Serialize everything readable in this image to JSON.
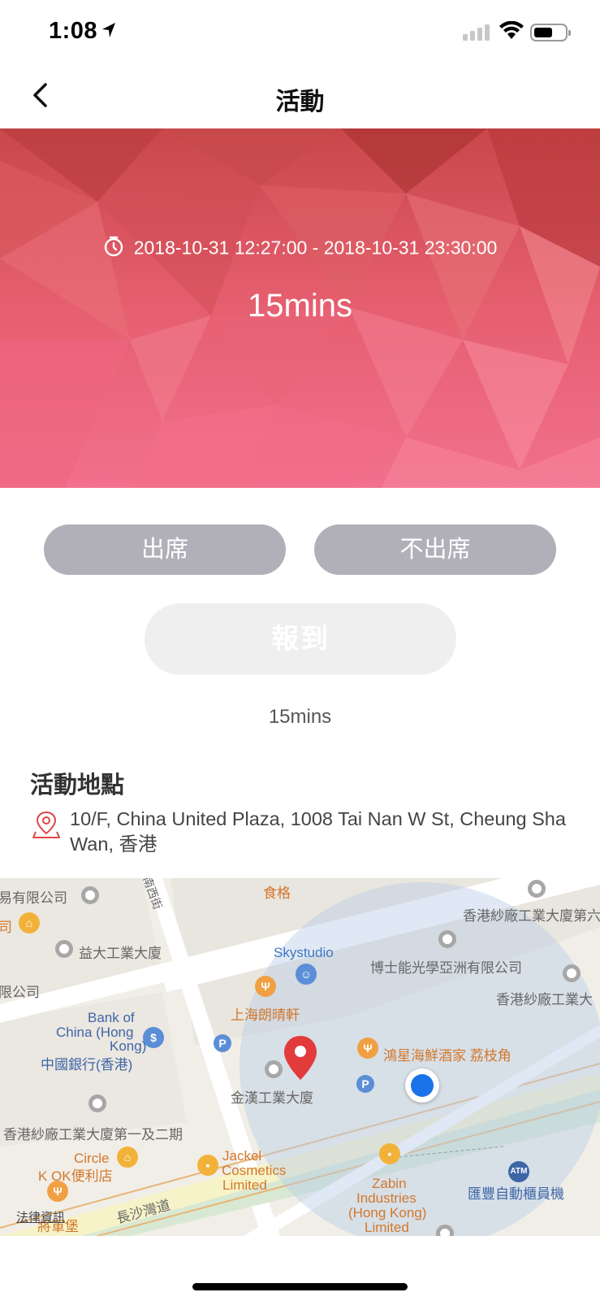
{
  "status_bar": {
    "time": "1:08",
    "icons": [
      "location-arrow-icon",
      "signal-icon",
      "wifi-icon",
      "battery-icon"
    ]
  },
  "nav": {
    "title": "活動",
    "back_icon": "chevron-left-icon"
  },
  "banner": {
    "time_range": "2018-10-31 12:27:00 - 2018-10-31 23:30:00",
    "duration": "15mins",
    "icon": "clock-icon"
  },
  "actions": {
    "attend_label": "出席",
    "absent_label": "不出席",
    "checkin_label": "報到",
    "remaining": "15mins"
  },
  "location": {
    "heading": "活動地點",
    "address": "10/F, China United Plaza, 1008 Tai Nan W St, Cheung Sha Wan, 香港",
    "icon": "map-pin-icon"
  },
  "map": {
    "legal": "法律資訊",
    "labels": {
      "l1": "易有限公司",
      "l2": "司",
      "l3": "益大工業大廈",
      "l4": "限公司",
      "l5": "Bank of",
      "l6": "China (Hong",
      "l7": "Kong)",
      "l8": "中國銀行(香港)",
      "l9": "香港紗廠工業大廈第一及二期",
      "l10": "Circle",
      "l11": "K OK便利店",
      "l12": "將軍堡",
      "l13": "長沙灣道",
      "l14": "食格",
      "l15": "Skystudio",
      "l16": "上海朗晴軒",
      "l17": "金漢工業大廈",
      "l18": "Jackel",
      "l19": "Cosmetics",
      "l20": "Limited",
      "l21": "香港紗廠工業大廈第六",
      "l22": "博士能光學亞洲有限公司",
      "l23": "香港紗廠工業大",
      "l24": "鴻星海鮮酒家 荔枝角",
      "l25": "Zabin",
      "l26": "Industries",
      "l27": "(Hong Kong)",
      "l28": "Limited",
      "l29": "匯豐自動櫃員機",
      "l30": "南西街",
      "atm": "ATM",
      "p": "P"
    }
  },
  "colors": {
    "banner_top": "#c9474a",
    "banner_bottom": "#f26b8a",
    "button_grey": "#b1b0b8",
    "checkin_bg": "#efefef",
    "pin_red": "#e23b3b",
    "user_blue": "#1a73e8"
  }
}
